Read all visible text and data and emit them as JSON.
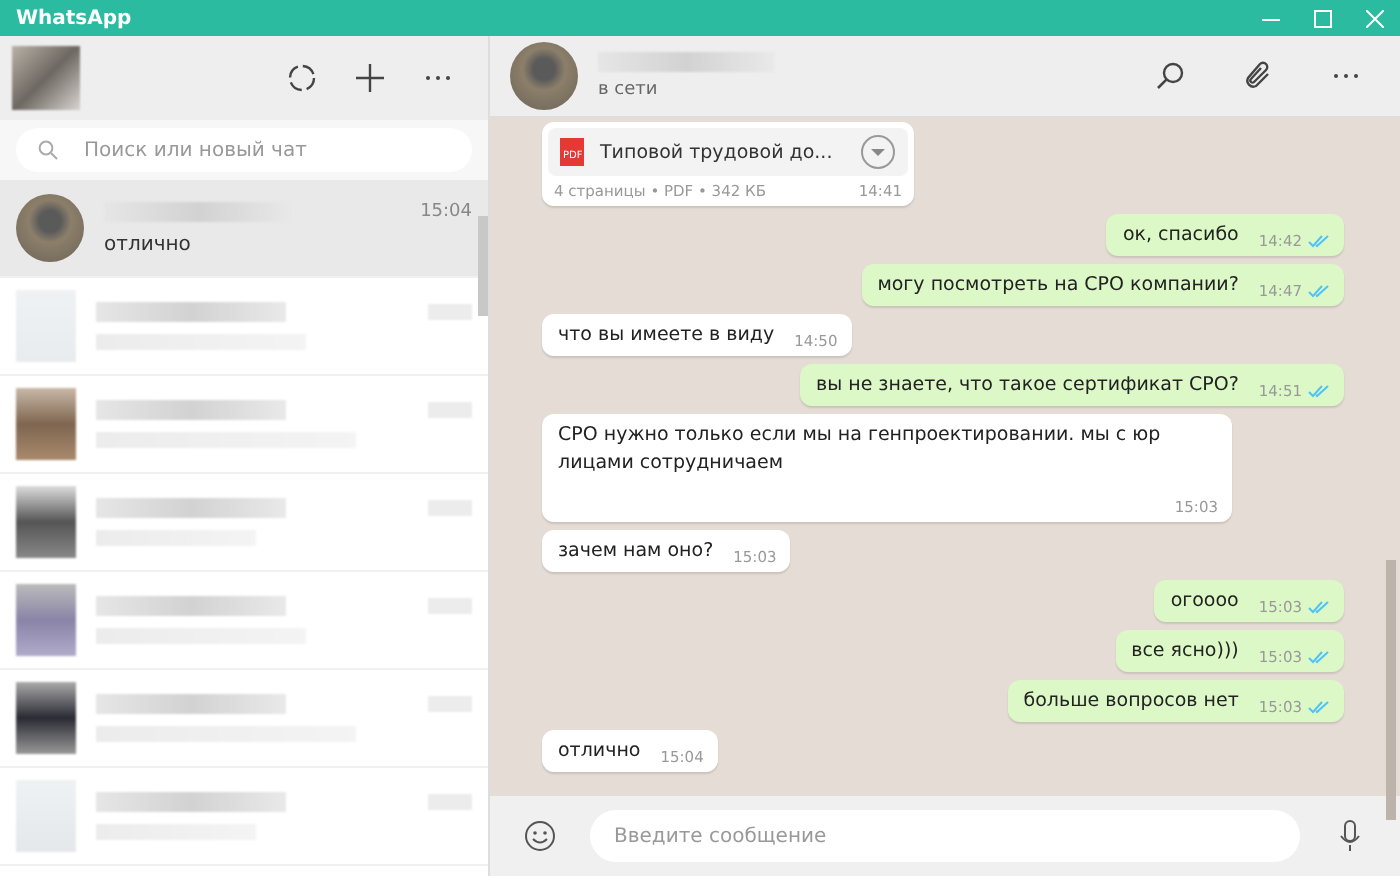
{
  "window": {
    "title": "WhatsApp"
  },
  "sidebar": {
    "search": {
      "placeholder": "Поиск или новый чат"
    },
    "chats": [
      {
        "kind": "photo",
        "time": "15:04",
        "preview": "отлично",
        "selected": true
      },
      {
        "kind": "blurred",
        "selected": false
      },
      {
        "kind": "blurred",
        "selected": false
      },
      {
        "kind": "blurred",
        "selected": false
      },
      {
        "kind": "blurred",
        "selected": false
      },
      {
        "kind": "blurred",
        "selected": false
      },
      {
        "kind": "blurred",
        "selected": false
      }
    ]
  },
  "chat": {
    "status": "в сети",
    "messages": [
      {
        "kind": "document",
        "outgoing": false,
        "badge": "PDF",
        "title": "Типовой трудовой до...",
        "meta": "4 страницы • PDF • 342 КБ",
        "time": "14:41"
      },
      {
        "kind": "text",
        "outgoing": true,
        "text": "ок, спасибо",
        "time": "14:42",
        "read": true
      },
      {
        "kind": "text",
        "outgoing": true,
        "text": "могу посмотреть на СРО компании?",
        "time": "14:47",
        "read": true
      },
      {
        "kind": "text",
        "outgoing": false,
        "text": "что вы имеете в виду",
        "time": "14:50"
      },
      {
        "kind": "text",
        "outgoing": true,
        "text": "вы не знаете, что такое сертификат СРО?",
        "time": "14:51",
        "read": true
      },
      {
        "kind": "text",
        "outgoing": false,
        "text": "СРО нужно только если мы на генпроектировании. мы с юр лицами сотрудничаем",
        "time": "15:03"
      },
      {
        "kind": "text",
        "outgoing": false,
        "text": "зачем нам оно?",
        "time": "15:03"
      },
      {
        "kind": "text",
        "outgoing": true,
        "text": "огоооо",
        "time": "15:03",
        "read": true
      },
      {
        "kind": "text",
        "outgoing": true,
        "text": "все ясно)))",
        "time": "15:03",
        "read": true
      },
      {
        "kind": "text",
        "outgoing": true,
        "text": "больше вопросов нет",
        "time": "15:03",
        "read": true
      },
      {
        "kind": "text",
        "outgoing": false,
        "text": "отлично",
        "time": "15:04"
      }
    ],
    "composer": {
      "placeholder": "Введите сообщение"
    }
  }
}
